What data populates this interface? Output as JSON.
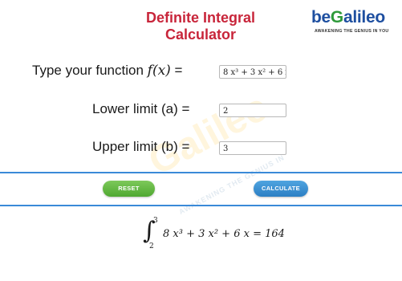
{
  "header": {
    "title_line1": "Definite Integral",
    "title_line2": "Calculator"
  },
  "logo": {
    "word_pre": "be",
    "word_g": "G",
    "word_post": "alileo",
    "tagline": "AWAKENING THE GENIUS IN YOU",
    "watermark": "Galileo",
    "watermark_tag": "AWAKENING THE GENIUS IN"
  },
  "form": {
    "function_label_prefix": "Type your function",
    "function_label_math": "f(x)",
    "function_label_suffix": "=",
    "function_value": "8 x³ + 3 x² + 6 x",
    "lower_label": "Lower limit (a) =",
    "lower_value": "2",
    "upper_label": "Upper limit (b) =",
    "upper_value": "3"
  },
  "buttons": {
    "reset": "RESET",
    "calculate": "CALCULATE"
  },
  "result": {
    "integral_symbol": "∫",
    "upper": "3",
    "lower": "2",
    "expression": "8 x³ + 3 x² + 6 x =  164"
  },
  "colors": {
    "title": "#c8253a",
    "divider": "#3a8ad8",
    "reset_button": "#5cb33b",
    "calculate_button": "#3a90d4"
  }
}
